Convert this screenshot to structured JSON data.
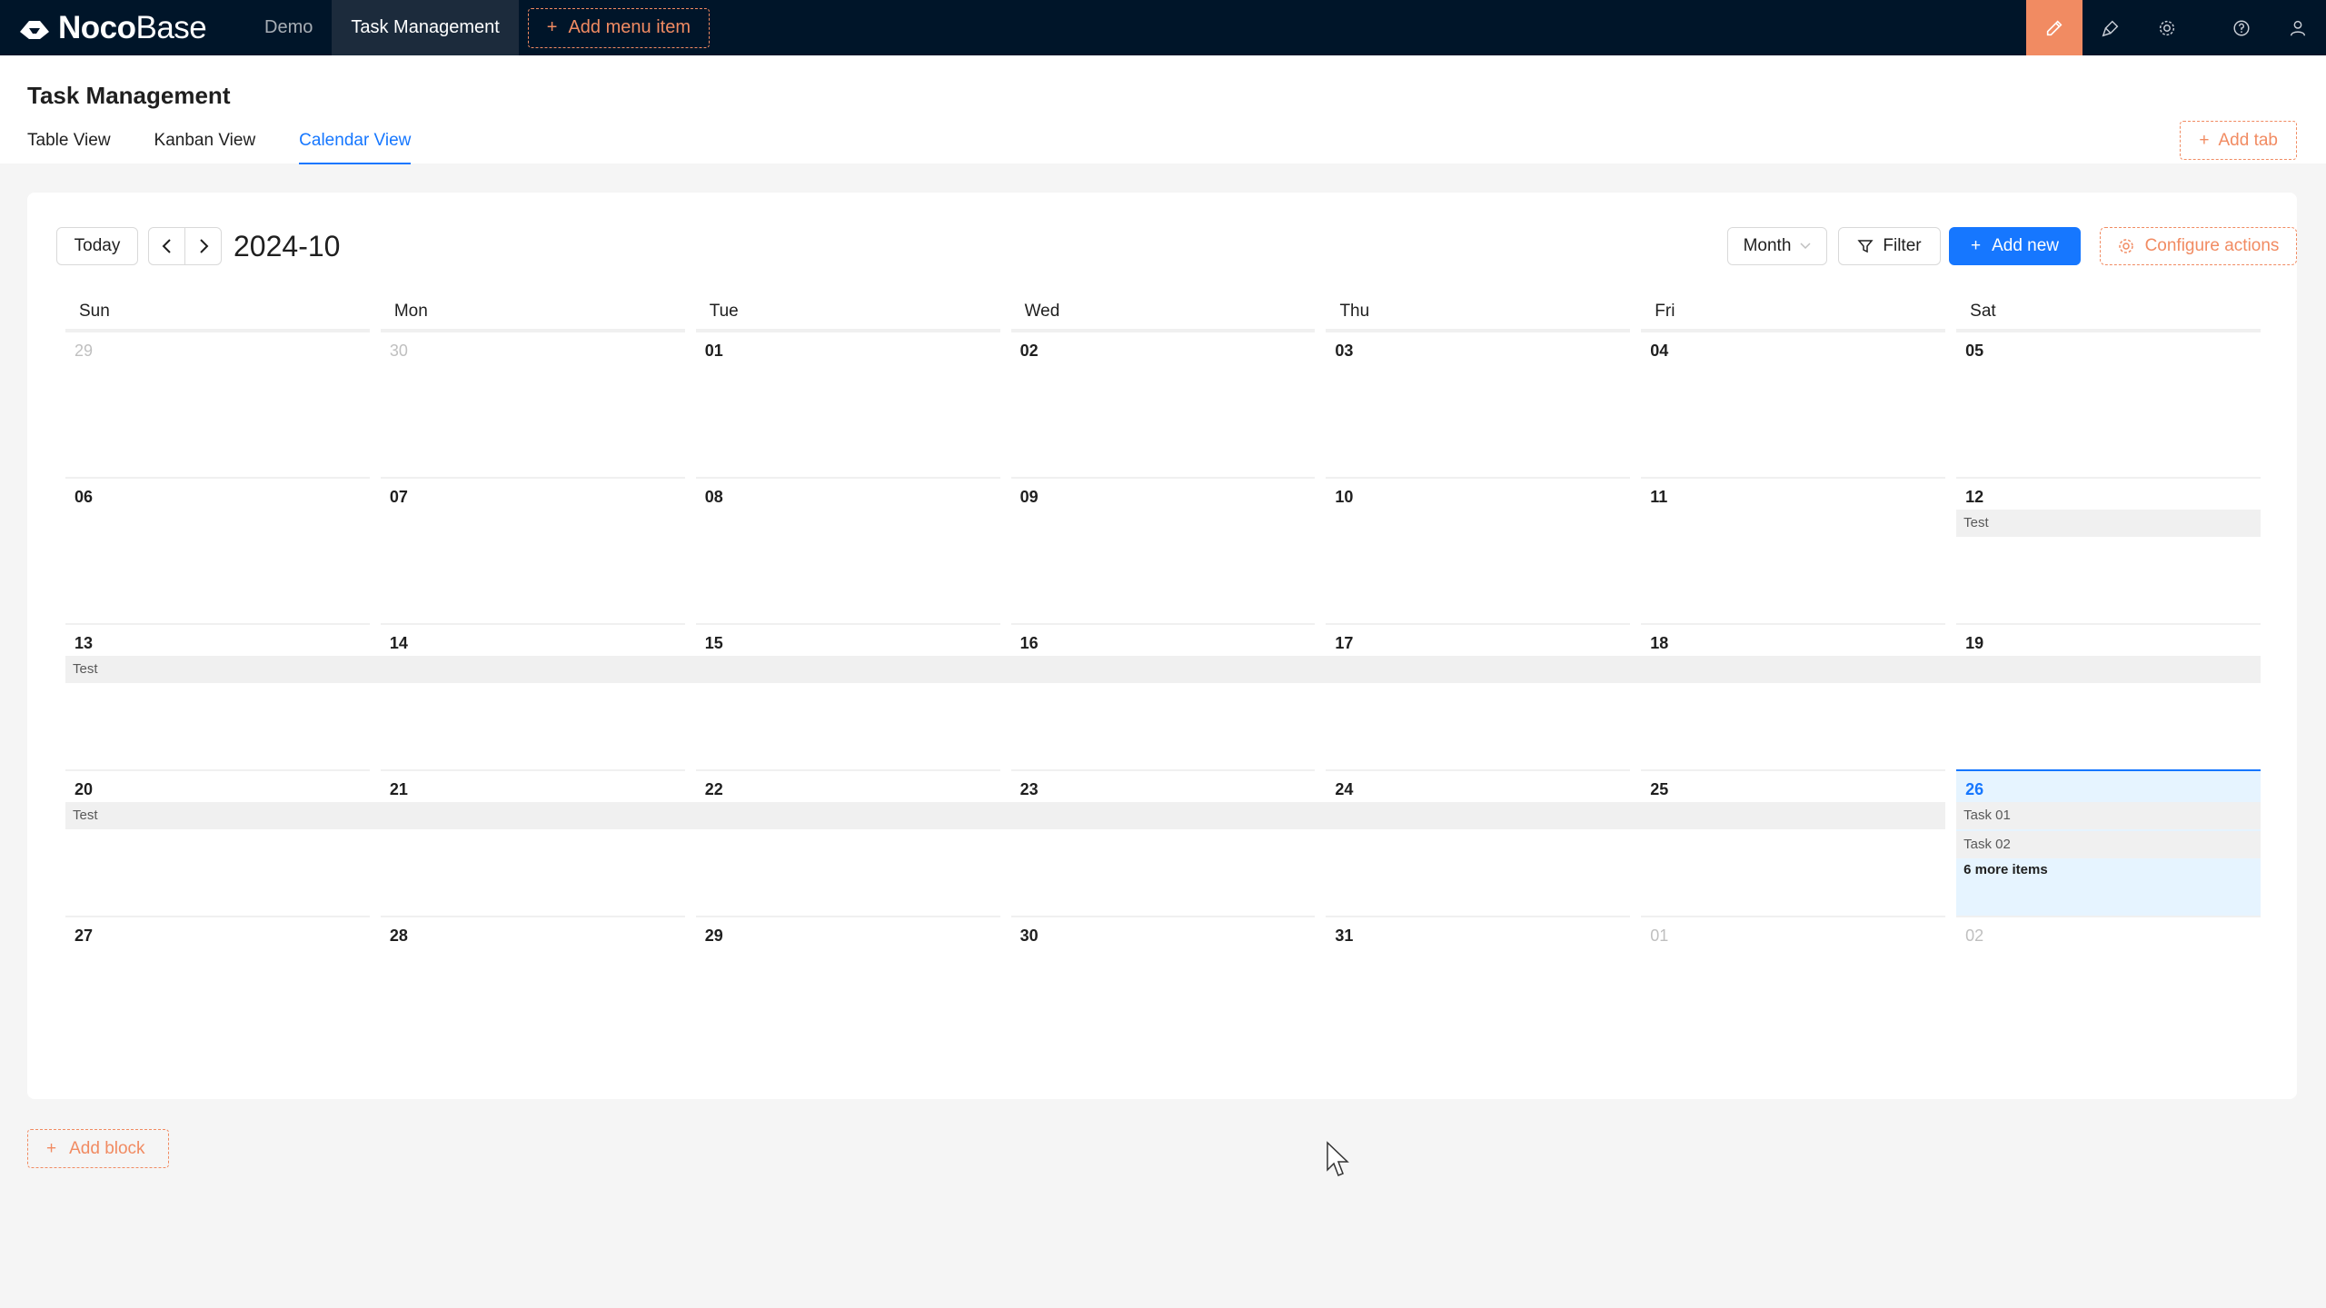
{
  "app": {
    "logo_bold": "Noco",
    "logo_light": "Base"
  },
  "topnav": {
    "items": [
      {
        "label": "Demo"
      },
      {
        "label": "Task Management"
      }
    ],
    "add_menu_label": "Add menu item",
    "icons": [
      "ui-editor-icon",
      "plugin-icon",
      "settings-icon",
      "help-icon",
      "user-icon"
    ]
  },
  "page": {
    "title": "Task Management",
    "tabs": [
      {
        "label": "Table View"
      },
      {
        "label": "Kanban View"
      },
      {
        "label": "Calendar View"
      }
    ],
    "active_tab": "Calendar View",
    "add_tab_label": "Add tab"
  },
  "calendar": {
    "today_label": "Today",
    "title": "2024-10",
    "view_select": "Month",
    "filter_label": "Filter",
    "add_new_label": "Add new",
    "configure_label": "Configure actions",
    "weekdays": [
      "Sun",
      "Mon",
      "Tue",
      "Wed",
      "Thu",
      "Fri",
      "Sat"
    ],
    "weeks": [
      [
        "29",
        "30",
        "01",
        "02",
        "03",
        "04",
        "05"
      ],
      [
        "06",
        "07",
        "08",
        "09",
        "10",
        "11",
        "12"
      ],
      [
        "13",
        "14",
        "15",
        "16",
        "17",
        "18",
        "19"
      ],
      [
        "20",
        "21",
        "22",
        "23",
        "24",
        "25",
        "26"
      ],
      [
        "27",
        "28",
        "29",
        "30",
        "31",
        "01",
        "02"
      ]
    ],
    "events": {
      "week2_sat": "Test",
      "week3_span": "Test",
      "week4_span": "Test",
      "today_task1": "Task 01",
      "today_task2": "Task 02",
      "today_more": "6 more items"
    }
  },
  "footer": {
    "add_block_label": "Add block"
  },
  "colors": {
    "accent": "#1677ff",
    "brand_orange": "#f18b62",
    "header": "#001529"
  }
}
